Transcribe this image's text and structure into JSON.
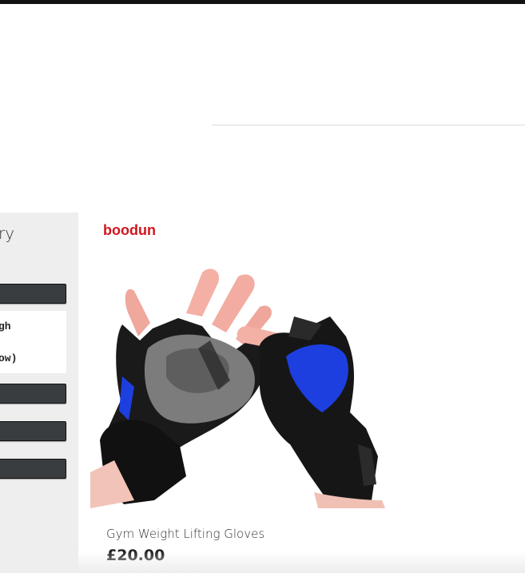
{
  "sidebar": {
    "title": "ry",
    "filter_options": [
      "gh",
      "ow)"
    ]
  },
  "product": {
    "brand": "boodun",
    "name": "Gym Weight Lifting Gloves",
    "price": "£20.00"
  },
  "colors": {
    "brand_red": "#d0161e",
    "sidebar_bg": "#eeeeee",
    "filter_button": "#3a3d40",
    "glove_blue": "#1d3fe0"
  }
}
